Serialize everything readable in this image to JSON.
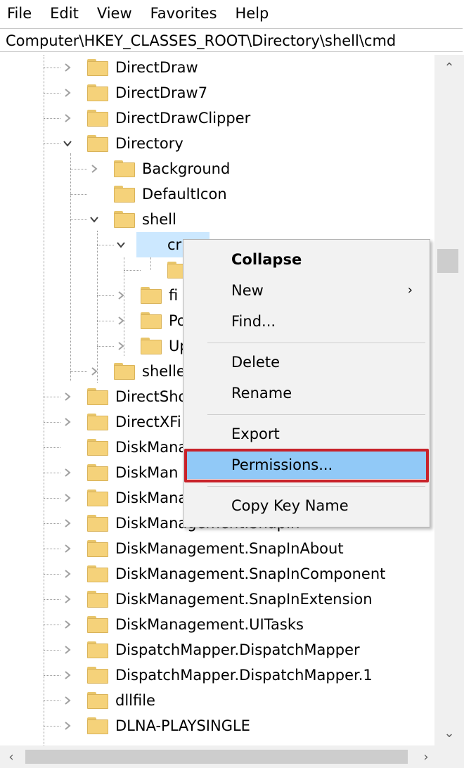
{
  "menu": [
    "File",
    "Edit",
    "View",
    "Favorites",
    "Help"
  ],
  "address": "Computer\\HKEY_CLASSES_ROOT\\Directory\\shell\\cmd",
  "tree": [
    {
      "label": "DirectDraw",
      "expander": "collapsed"
    },
    {
      "label": "DirectDraw7",
      "expander": "collapsed"
    },
    {
      "label": "DirectDrawClipper",
      "expander": "collapsed"
    },
    {
      "label": "Directory",
      "expander": "expanded"
    },
    {
      "label": "Background",
      "expander": "collapsed"
    },
    {
      "label": "DefaultIcon",
      "expander": "none"
    },
    {
      "label": "shell",
      "expander": "expanded"
    },
    {
      "label": "cr",
      "expander": "expanded",
      "selected": true
    },
    {
      "label": "",
      "expander": "none"
    },
    {
      "label": "fi",
      "expander": "collapsed"
    },
    {
      "label": "Po",
      "expander": "collapsed"
    },
    {
      "label": "Up",
      "expander": "collapsed"
    },
    {
      "label": "shelle",
      "expander": "collapsed"
    },
    {
      "label": "DirectSho",
      "expander": "collapsed"
    },
    {
      "label": "DirectXFi",
      "expander": "collapsed"
    },
    {
      "label": "DiskMana",
      "expander": "none"
    },
    {
      "label": "DiskMan",
      "expander": "collapsed"
    },
    {
      "label": "DiskMana",
      "expander": "collapsed"
    },
    {
      "label": "DiskManagement.SnapIn",
      "expander": "collapsed"
    },
    {
      "label": "DiskManagement.SnapInAbout",
      "expander": "collapsed"
    },
    {
      "label": "DiskManagement.SnapInComponent",
      "expander": "collapsed"
    },
    {
      "label": "DiskManagement.SnapInExtension",
      "expander": "collapsed"
    },
    {
      "label": "DiskManagement.UITasks",
      "expander": "collapsed"
    },
    {
      "label": "DispatchMapper.DispatchMapper",
      "expander": "collapsed"
    },
    {
      "label": "DispatchMapper.DispatchMapper.1",
      "expander": "collapsed"
    },
    {
      "label": "dllfile",
      "expander": "collapsed"
    },
    {
      "label": "DLNA-PLAYSINGLE",
      "expander": "collapsed"
    }
  ],
  "context_menu": {
    "items": [
      {
        "label": "Collapse",
        "bold": true
      },
      {
        "label": "New",
        "submenu": true
      },
      {
        "label": "Find..."
      },
      {
        "separator": true
      },
      {
        "label": "Delete"
      },
      {
        "label": "Rename"
      },
      {
        "separator": true
      },
      {
        "label": "Export"
      },
      {
        "label": "Permissions...",
        "highlighted": true
      },
      {
        "separator": true
      },
      {
        "label": "Copy Key Name"
      }
    ]
  },
  "colors": {
    "highlight_box": "#c8222a",
    "menu_hover": "#91c9f7",
    "selection": "#cce8ff",
    "folder": "#f5d27a"
  }
}
